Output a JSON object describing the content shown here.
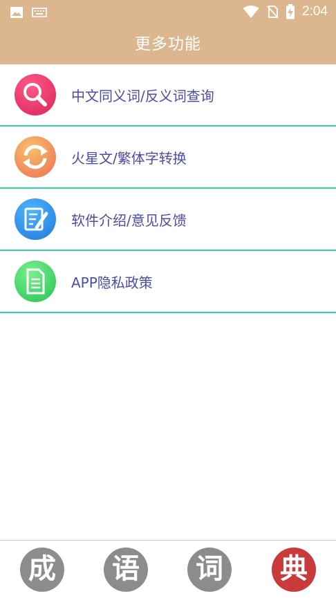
{
  "status_bar": {
    "time": "2:04",
    "icons": [
      "image-icon",
      "keyboard-icon",
      "wifi-icon",
      "no-sim-icon",
      "battery-charging-icon"
    ]
  },
  "header": {
    "title": "更多功能"
  },
  "menu": {
    "items": [
      {
        "label": "中文同义词/反义词查询",
        "icon": "search-icon",
        "color": "#e8336b"
      },
      {
        "label": "火星文/繁体字转换",
        "icon": "convert-icon",
        "color": "#ee7a5b"
      },
      {
        "label": "软件介绍/意见反馈",
        "icon": "edit-note-icon",
        "color": "#2b8fe0"
      },
      {
        "label": "APP隐私政策",
        "icon": "document-icon",
        "color": "#33c95a"
      }
    ],
    "divider_color": "#2ad1b4"
  },
  "bottom_nav": {
    "tabs": [
      {
        "char": "成",
        "active": false
      },
      {
        "char": "语",
        "active": false
      },
      {
        "char": "词",
        "active": false
      },
      {
        "char": "典",
        "active": true
      }
    ]
  },
  "colors": {
    "header_bg": "#dbb68e",
    "label_text": "#4b4ba8",
    "active_tab": "#c93a3a",
    "inactive_tab": "#8c8c8c"
  }
}
